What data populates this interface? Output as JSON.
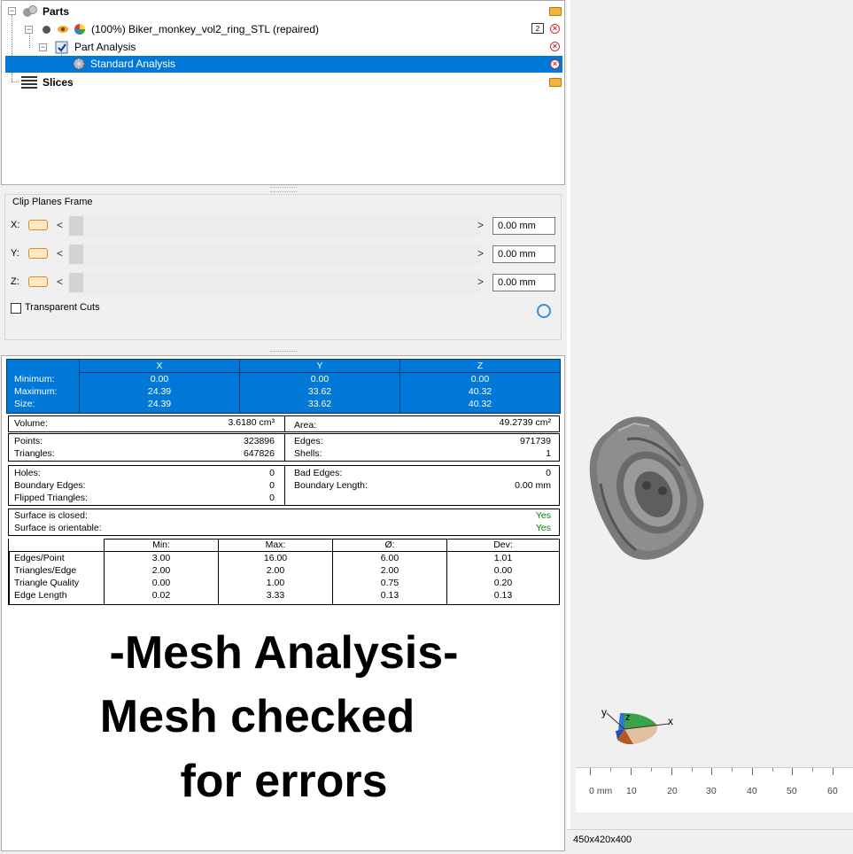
{
  "tree": {
    "parts_label": "Parts",
    "item_label": "(100%) Biker_monkey_vol2_ring_STL (repaired)",
    "item_badge": "2",
    "analysis_label": "Part Analysis",
    "standard_label": "Standard Analysis",
    "slices_label": "Slices"
  },
  "clip": {
    "title": "Clip Planes Frame",
    "rows": [
      {
        "axis": "X:",
        "value": "0.00 mm"
      },
      {
        "axis": "Y:",
        "value": "0.00 mm"
      },
      {
        "axis": "Z:",
        "value": "0.00 mm"
      }
    ],
    "transparent_label": "Transparent Cuts",
    "left_arrow": "<",
    "right_arrow": ">"
  },
  "report": {
    "bbox": {
      "headers": [
        "X",
        "Y",
        "Z"
      ],
      "rows": [
        {
          "label": "Minimum:",
          "values": [
            "0.00",
            "0.00",
            "0.00"
          ]
        },
        {
          "label": "Maximum:",
          "values": [
            "24.39",
            "33.62",
            "40.32"
          ]
        },
        {
          "label": "Size:",
          "values": [
            "24.39",
            "33.62",
            "40.32"
          ]
        }
      ]
    },
    "volume_label": "Volume:",
    "volume_value": "3.6180 cm³",
    "area_label": "Area:",
    "area_value": "49.2739 cm²",
    "points_label": "Points:",
    "points_value": "323896",
    "triangles_label": "Triangles:",
    "triangles_value": "647826",
    "edges_label": "Edges:",
    "edges_value": "971739",
    "shells_label": "Shells:",
    "shells_value": "1",
    "holes_label": "Holes:",
    "holes_value": "0",
    "boundary_edges_label": "Boundary Edges:",
    "boundary_edges_value": "0",
    "flipped_label": "Flipped Triangles:",
    "flipped_value": "0",
    "bad_edges_label": "Bad Edges:",
    "bad_edges_value": "0",
    "boundary_length_label": "Boundary Length:",
    "boundary_length_value": "0.00 mm",
    "closed_label": "Surface is closed:",
    "closed_value": "Yes",
    "orientable_label": "Surface is orientable:",
    "orientable_value": "Yes",
    "stats": {
      "headers": [
        "Min:",
        "Max:",
        "Ø:",
        "Dev:"
      ],
      "rows": [
        {
          "label": "Edges/Point",
          "values": [
            "3.00",
            "16.00",
            "6.00",
            "1.01"
          ]
        },
        {
          "label": "Triangles/Edge",
          "values": [
            "2.00",
            "2.00",
            "2.00",
            "0.00"
          ]
        },
        {
          "label": "Triangle Quality",
          "values": [
            "0.00",
            "1.00",
            "0.75",
            "0.20"
          ]
        },
        {
          "label": "Edge Length",
          "values": [
            "0.02",
            "3.33",
            "0.13",
            "0.13"
          ]
        }
      ]
    }
  },
  "overlay": {
    "line1": "-Mesh Analysis-",
    "line2": "Mesh checked",
    "line3": "for errors"
  },
  "viewport": {
    "axis_x": "x",
    "axis_y": "y",
    "axis_z": "z",
    "ruler_labels": [
      "0 mm",
      "10",
      "20",
      "30",
      "40",
      "50",
      "60"
    ],
    "status": "450x420x400"
  },
  "colors": {
    "selection": "#0078d7",
    "ok_green": "#008800",
    "error_red": "#d32f2f"
  }
}
